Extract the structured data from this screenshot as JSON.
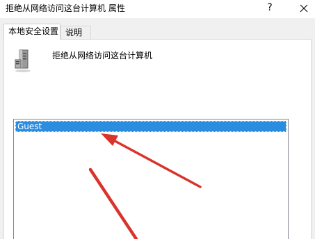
{
  "window": {
    "title": "拒绝从网络访问这台计算机 属性",
    "help_label": "?",
    "close_icon": "close-icon"
  },
  "tabs": [
    {
      "label": "本地安全设置",
      "selected": true
    },
    {
      "label": "说明",
      "selected": false
    }
  ],
  "policy": {
    "icon": "server-icon",
    "name": "拒绝从网络访问这台计算机"
  },
  "accounts": {
    "items": [
      {
        "label": "Guest",
        "selected": true
      }
    ]
  },
  "colors": {
    "selection": "#2b8de0",
    "annotation_arrow": "#d9342b"
  }
}
